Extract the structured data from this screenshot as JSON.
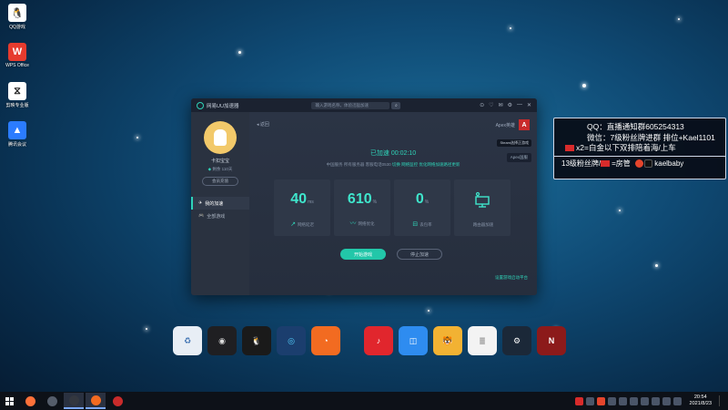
{
  "desktop_icons": [
    {
      "name": "qq-game",
      "label": "QQ游戏",
      "color": "#ffffff",
      "glyph": "🐧"
    },
    {
      "name": "wps-office",
      "label": "WPS Office",
      "color": "#e63b2e",
      "glyph": "W"
    },
    {
      "name": "capcut",
      "label": "剪映专业版",
      "color": "#ffffff",
      "glyph": "⧖"
    },
    {
      "name": "tencent-meeting",
      "label": "腾讯会议",
      "color": "#2b7cff",
      "glyph": "▲"
    }
  ],
  "app": {
    "title": "网易UU加速器",
    "search_placeholder": "输入游戏名称，体验迅猛加速",
    "window_controls": [
      "⊙",
      "♡",
      "✉",
      "⚙",
      "—",
      "✕"
    ],
    "sidebar": {
      "username": "卡扣宝宝",
      "vip_prefix": "剩余",
      "vip_value": "110天",
      "open_btn": "会员充值",
      "nav": [
        {
          "label": "我的加速",
          "icon": "rocket-icon",
          "glyph": "✈",
          "active": true
        },
        {
          "label": "全部游戏",
          "icon": "gamepad-icon",
          "glyph": "🎮",
          "active": false
        }
      ]
    },
    "main": {
      "back_label": "返回",
      "game_name": "Apex英雄",
      "steam_tag": "Steam选择正游戏",
      "apex_tag": "Apex国服",
      "status": "已加速 00:02:10",
      "stats_line": {
        "prefix": "中国服务 所有服务器",
        "middle": "客服电话0530",
        "switch": "切换",
        "monitor": "网络监控",
        "update": "优化网络加速路径更新"
      },
      "cards": [
        {
          "value": "40",
          "unit": "ms",
          "label": "网络延迟",
          "icon": "↗"
        },
        {
          "value": "610",
          "unit": "%",
          "label": "网络优化",
          "icon": "〰"
        },
        {
          "value": "0",
          "unit": "%",
          "label": "丢包率",
          "icon": "⊟"
        },
        {
          "value": "",
          "unit": "",
          "label": "路由器加速",
          "icon": ""
        }
      ],
      "start_btn": "开始游戏",
      "stop_btn": "停止加速",
      "settings_link": "设置游戏启动平台"
    }
  },
  "overlay": {
    "line1": "QQ：直播通知群605254313",
    "line2": "微信：7级粉丝牌进群 排位+Kael1101",
    "line3": "x2=白金以下双排陪着海/上车",
    "line4_a": "13级粉丝牌/",
    "line4_b": "=房管",
    "line4_c": "kaelbaby"
  },
  "dock": [
    {
      "name": "recycle-bin",
      "color": "#e8eef5",
      "glyph": "♻",
      "fg": "#3a6fb0"
    },
    {
      "name": "obs-studio",
      "color": "#1f1f22",
      "glyph": "◉",
      "fg": "#ddd"
    },
    {
      "name": "qq",
      "color": "#1a1a1a",
      "glyph": "🐧",
      "fg": "#fff"
    },
    {
      "name": "uu-accelerator",
      "color": "#1b3e6e",
      "glyph": "◎",
      "fg": "#55d2ff"
    },
    {
      "name": "origin",
      "color": "#f26b21",
      "glyph": "◔",
      "fg": "#fff"
    },
    {
      "name": "netease-music",
      "color": "#e1262d",
      "glyph": "♪",
      "fg": "#fff"
    },
    {
      "name": "bilibili-live",
      "color": "#2e8cf0",
      "glyph": "◫",
      "fg": "#fff"
    },
    {
      "name": "doudou-pet",
      "color": "#f2b233",
      "glyph": "🐯",
      "fg": "#fff"
    },
    {
      "name": "text-file",
      "color": "#f3f3f3",
      "glyph": "≣",
      "fg": "#888"
    },
    {
      "name": "steam",
      "color": "#1b2838",
      "glyph": "⚙",
      "fg": "#fff"
    },
    {
      "name": "naraka",
      "color": "#8c1a1a",
      "glyph": "N",
      "fg": "#fff"
    }
  ],
  "taskbar": {
    "apps": [
      {
        "name": "firefox",
        "color": "#ff7139",
        "active": false
      },
      {
        "name": "settings-app",
        "color": "#555d6b",
        "active": false
      },
      {
        "name": "obs-taskbar",
        "color": "#33373f",
        "active": true
      },
      {
        "name": "origin-taskbar",
        "color": "#f26b21",
        "active": true
      },
      {
        "name": "apex-taskbar",
        "color": "#c92b2b",
        "active": false
      }
    ],
    "time": "20:54",
    "date": "2021/8/23"
  }
}
